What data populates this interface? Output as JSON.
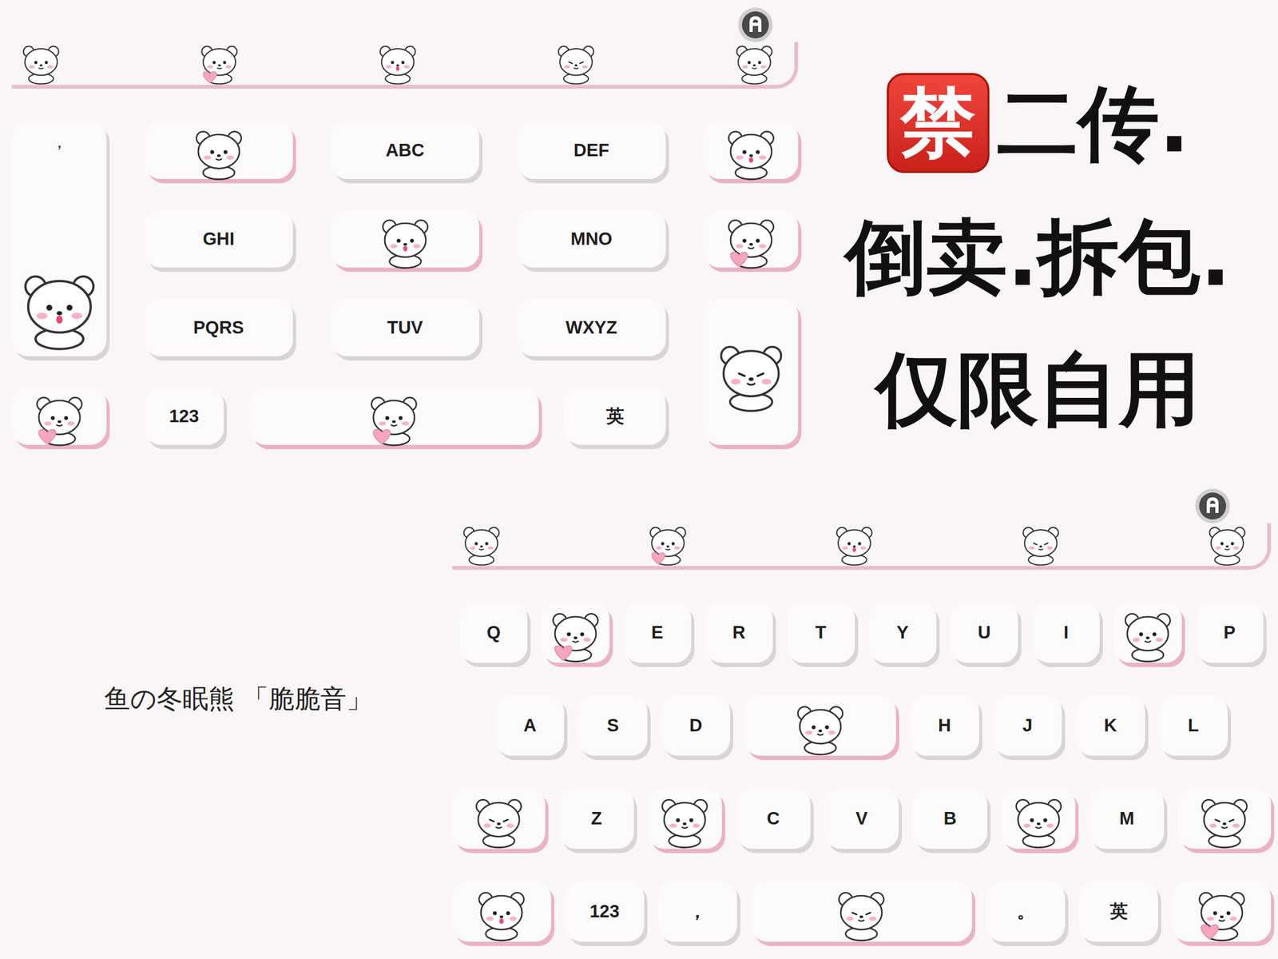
{
  "nine_key": {
    "side_key": {
      "label": "，"
    },
    "rows": [
      [
        {
          "kind": "sticker"
        },
        {
          "kind": "key",
          "label": "ABC"
        },
        {
          "kind": "key",
          "label": "DEF"
        },
        {
          "kind": "sticker"
        }
      ],
      [
        {
          "kind": "key",
          "label": "GHI"
        },
        {
          "kind": "sticker"
        },
        {
          "kind": "key",
          "label": "MNO"
        },
        {
          "kind": "sticker"
        }
      ],
      [
        {
          "kind": "key",
          "label": "PQRS"
        },
        {
          "kind": "key",
          "label": "TUV"
        },
        {
          "kind": "key",
          "label": "WXYZ"
        }
      ]
    ],
    "bottom_row": [
      {
        "kind": "sticker"
      },
      {
        "kind": "key",
        "label": "123"
      },
      {
        "kind": "space"
      },
      {
        "kind": "key",
        "label": "英"
      }
    ]
  },
  "notice": {
    "badge": "禁",
    "lines": [
      "二传.",
      "倒卖.拆包.",
      "仅限自用"
    ]
  },
  "watermark": "鱼の冬眠熊 「脆脆音」",
  "qwerty": {
    "rows": [
      [
        {
          "kind": "key",
          "label": "Q"
        },
        {
          "kind": "sticker"
        },
        {
          "kind": "key",
          "label": "E"
        },
        {
          "kind": "key",
          "label": "R"
        },
        {
          "kind": "key",
          "label": "T"
        },
        {
          "kind": "key",
          "label": "Y"
        },
        {
          "kind": "key",
          "label": "U"
        },
        {
          "kind": "key",
          "label": "I"
        },
        {
          "kind": "sticker"
        },
        {
          "kind": "key",
          "label": "P"
        }
      ],
      [
        {
          "kind": "key",
          "label": "A"
        },
        {
          "kind": "key",
          "label": "S"
        },
        {
          "kind": "key",
          "label": "D"
        },
        {
          "kind": "wide"
        },
        {
          "kind": "key",
          "label": "H"
        },
        {
          "kind": "key",
          "label": "J"
        },
        {
          "kind": "key",
          "label": "K"
        },
        {
          "kind": "key",
          "label": "L"
        }
      ],
      [
        {
          "kind": "sticker"
        },
        {
          "kind": "key",
          "label": "Z"
        },
        {
          "kind": "sticker"
        },
        {
          "kind": "key",
          "label": "C"
        },
        {
          "kind": "key",
          "label": "V"
        },
        {
          "kind": "key",
          "label": "B"
        },
        {
          "kind": "sticker"
        },
        {
          "kind": "key",
          "label": "M"
        },
        {
          "kind": "sticker"
        }
      ],
      [
        {
          "kind": "sticker"
        },
        {
          "kind": "key",
          "label": "123"
        },
        {
          "kind": "key",
          "label": "，"
        },
        {
          "kind": "space"
        },
        {
          "kind": "key",
          "label": "。"
        },
        {
          "kind": "key",
          "label": "英"
        },
        {
          "kind": "sticker"
        }
      ]
    ]
  }
}
